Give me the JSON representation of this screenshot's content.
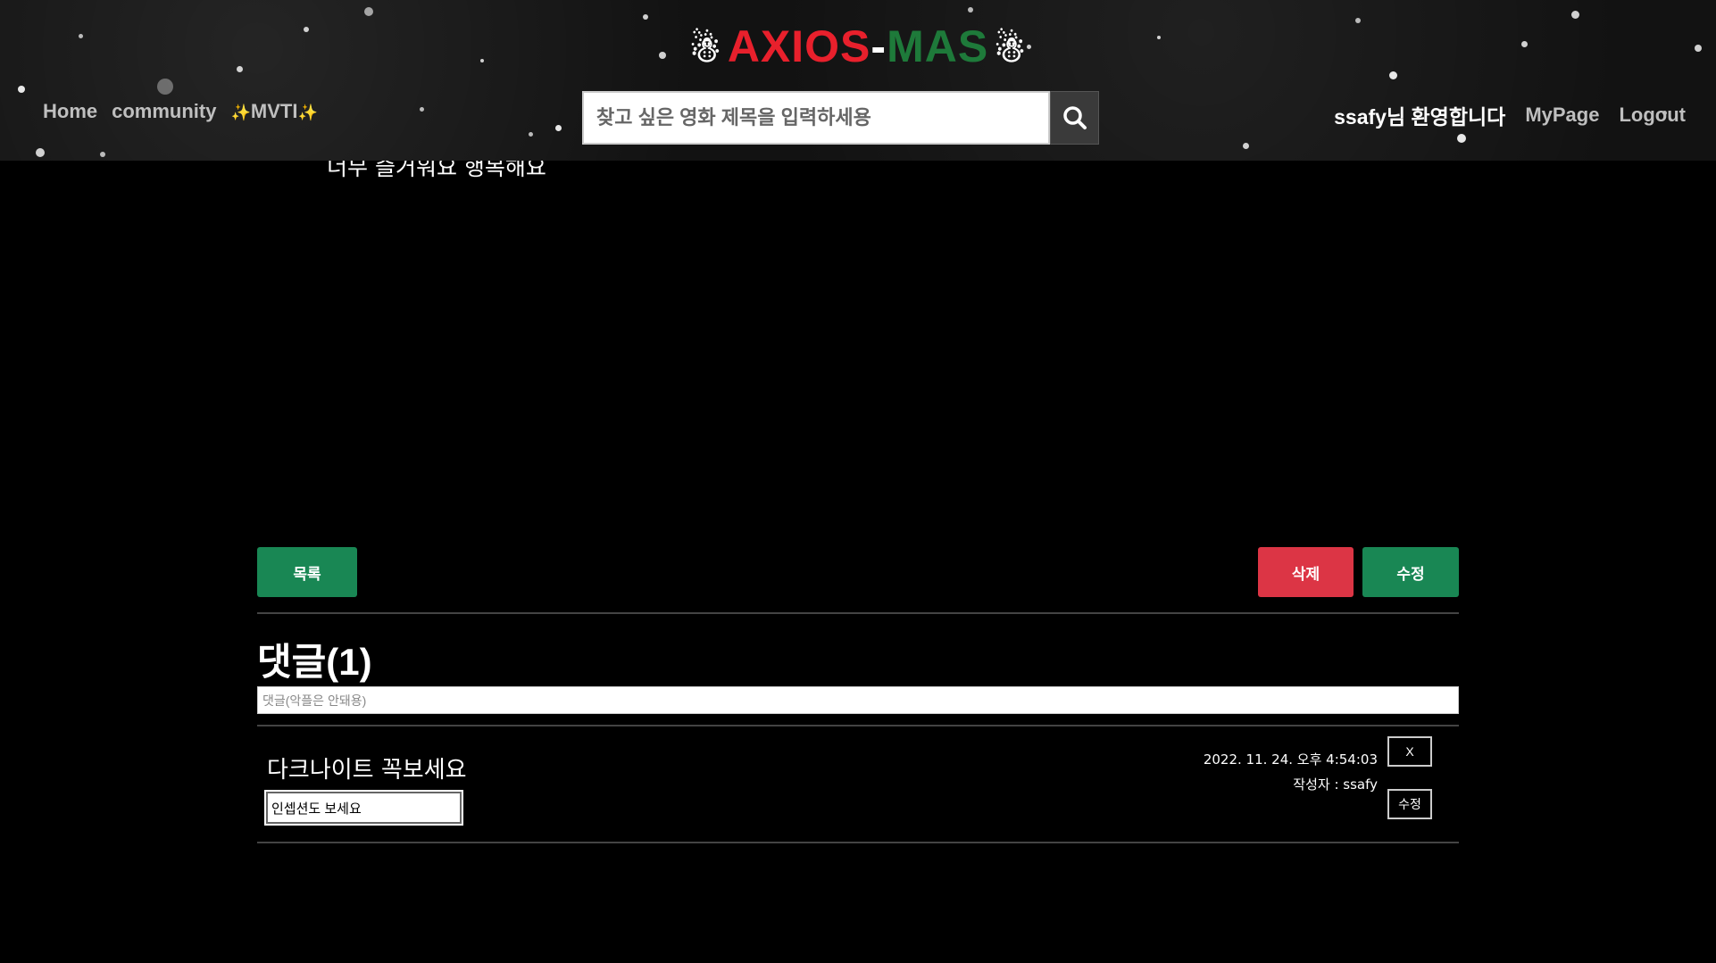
{
  "header": {
    "logo": {
      "part1": "AXIOS",
      "dash": "-",
      "part2": "MAS",
      "snowman": "☃"
    },
    "nav": {
      "home": "Home",
      "community": "community",
      "mvti": "MVTI",
      "sparkle": "✨"
    },
    "search": {
      "placeholder": "찾고 싶은 영화 제목을 입력하세용",
      "icon": "search-icon"
    },
    "welcome": "ssafy님 환영합니다",
    "mypage": "MyPage",
    "logout": "Logout"
  },
  "post": {
    "body": "너무 즐거워요 행복해요"
  },
  "actions": {
    "list_label": "목록",
    "delete_label": "삭제",
    "edit_label": "수정"
  },
  "comments": {
    "title": "댓글(1)",
    "input_placeholder": "댓글(악플은 안돼용)",
    "items": [
      {
        "content": "다크나이트 꼭보세요",
        "edit_value": "인셉션도 보세요",
        "date": "2022. 11. 24. 오후 4:54:03",
        "author": "작성자 : ssafy",
        "delete_label": "X",
        "edit_label": "수정"
      }
    ]
  },
  "colors": {
    "logo_red": "#e8202c",
    "logo_green": "#1e7a3a",
    "btn_green": "#198754",
    "btn_red": "#dc3545"
  }
}
